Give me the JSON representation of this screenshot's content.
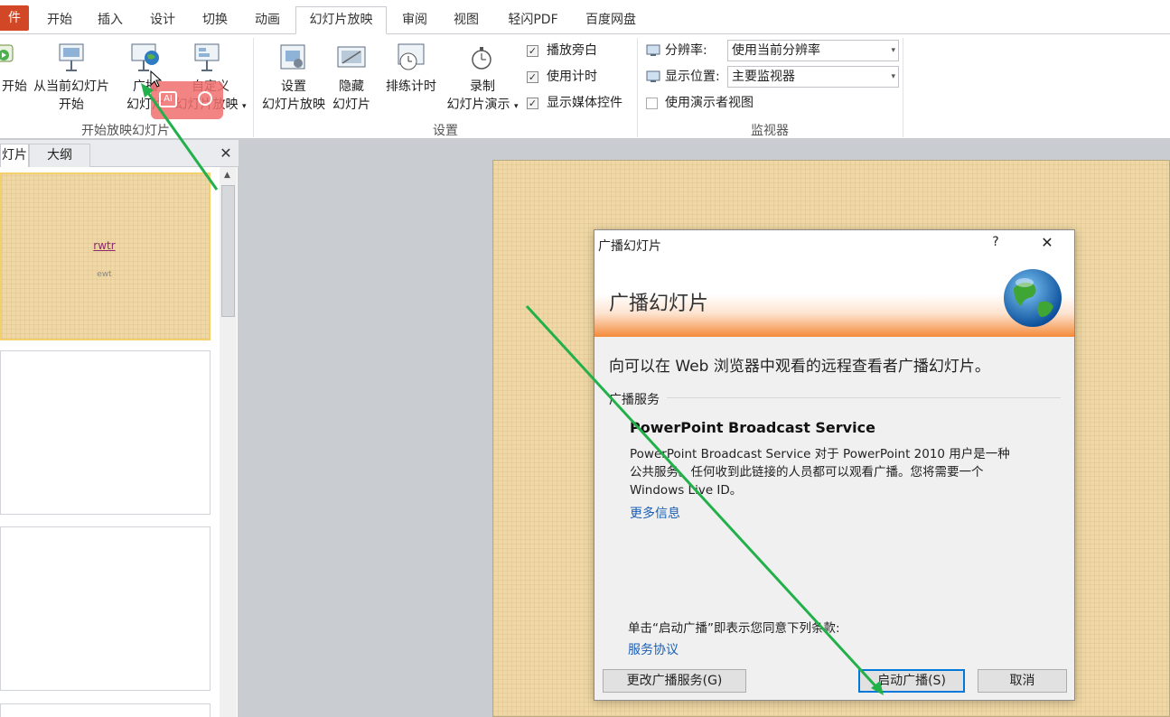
{
  "tabs": [
    "件",
    "开始",
    "插入",
    "设计",
    "切换",
    "动画",
    "幻灯片放映",
    "审阅",
    "视图",
    "轻闪PDF",
    "百度网盘"
  ],
  "ribbon": {
    "start": {
      "btn_begin": "开始",
      "btn_current_l1": "从当前幻灯片",
      "btn_current_l2": "开始",
      "btn_broadcast_l1": "广播",
      "btn_broadcast_l2": "幻灯片",
      "btn_custom_l1": "自定义",
      "btn_custom_l2": "幻灯片放映",
      "group": "开始放映幻灯片"
    },
    "setup": {
      "btn_setup_l1": "设置",
      "btn_setup_l2": "幻灯片放映",
      "btn_hide_l1": "隐藏",
      "btn_hide_l2": "幻灯片",
      "btn_rehearse": "排练计时",
      "btn_record_l1": "录制",
      "btn_record_l2": "幻灯片演示",
      "chk_narration": "播放旁白",
      "chk_timing": "使用计时",
      "chk_media": "显示媒体控件",
      "group": "设置"
    },
    "monitor": {
      "resolution_label": "分辨率:",
      "resolution_value": "使用当前分辨率",
      "display_label": "显示位置:",
      "display_value": "主要监视器",
      "presenter_view": "使用演示者视图",
      "group": "监视器"
    }
  },
  "overlay_badge": "AI",
  "left_pane": {
    "tab_slides": "灯片",
    "tab_outline": "大纲",
    "close": "✕",
    "thumb_title": "rwtr",
    "thumb_subtitle": "ewt"
  },
  "dialog": {
    "title": "广播幻灯片",
    "help": "?",
    "close": "✕",
    "banner": "广播幻灯片",
    "intro": "向可以在 Web 浏览器中观看的远程查看者广播幻灯片。",
    "section": "广播服务",
    "service_name": "PowerPoint Broadcast Service",
    "service_desc_1": "PowerPoint Broadcast Service 对于 PowerPoint 2010 用户是一种",
    "service_desc_2": "公共服务。任何收到此链接的人员都可以观看广播。您将需要一个",
    "service_desc_3": "Windows Live ID。",
    "more_info": "更多信息",
    "terms_text": "单击“启动广播”即表示您同意下列条款:",
    "terms_link": "服务协议",
    "btn_change": "更改广播服务(G)",
    "btn_start": "启动广播(S)",
    "btn_cancel": "取消"
  },
  "colors": {
    "accent": "#d24726",
    "annotation": "#22b04b",
    "link": "#1b5fb5"
  }
}
